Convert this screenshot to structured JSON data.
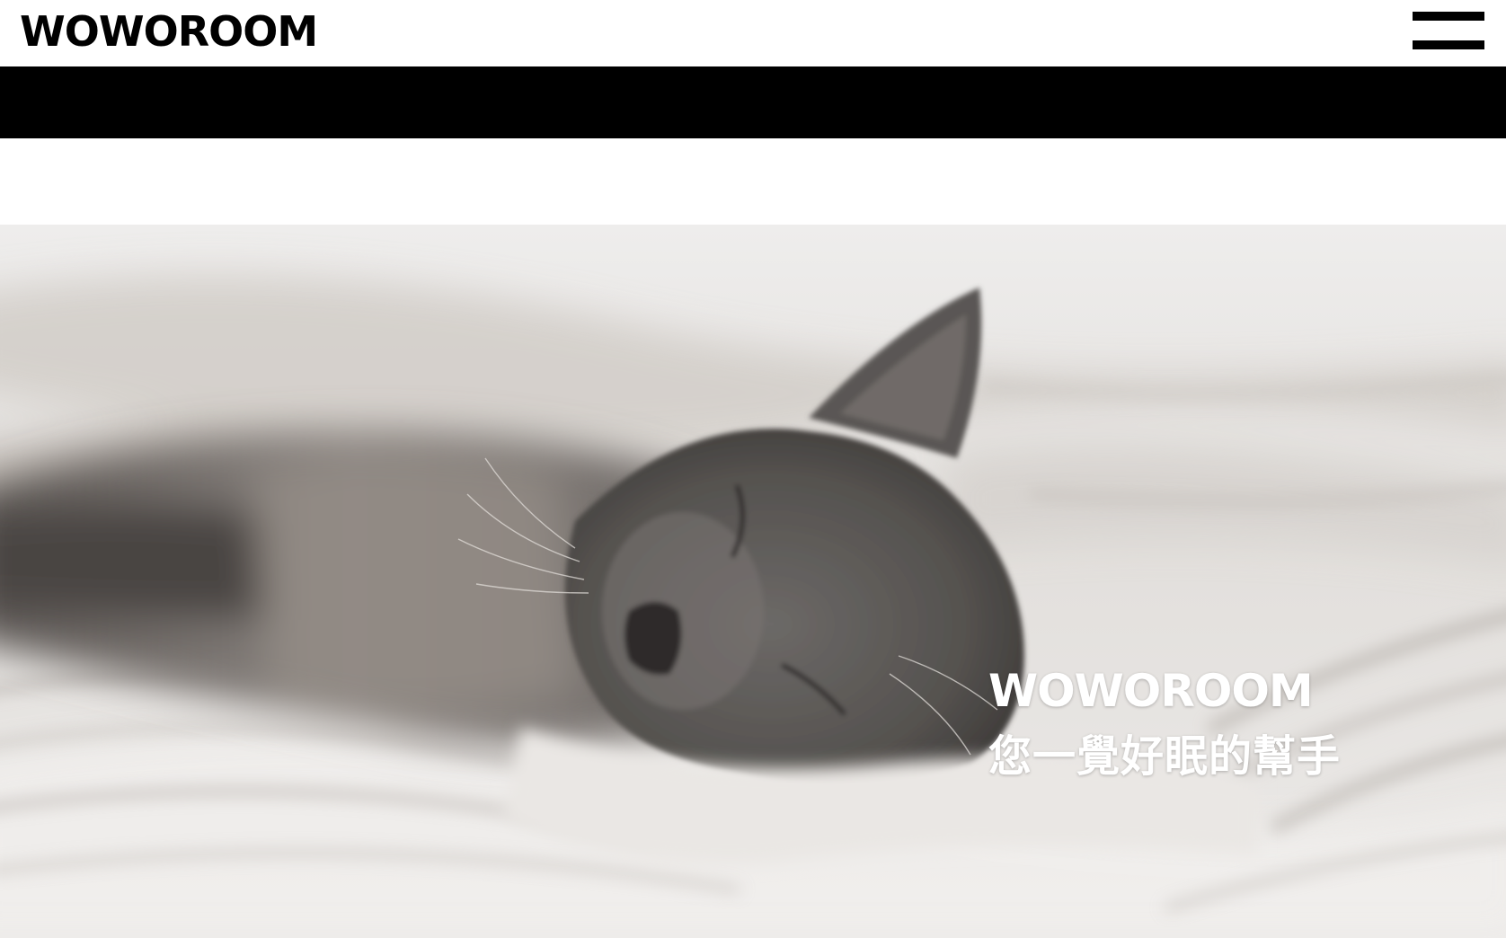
{
  "header": {
    "logo": "WOWOROOM",
    "menu_icon": "hamburger-menu-icon"
  },
  "hero": {
    "image": "sleeping-gray-cat-on-bed-photo",
    "brand": "WOWOROOM",
    "slogan": "您一覺好眠的幫手"
  },
  "colors": {
    "text": "#000000",
    "background": "#ffffff",
    "strip": "#000000",
    "caption": "#ffffff"
  }
}
